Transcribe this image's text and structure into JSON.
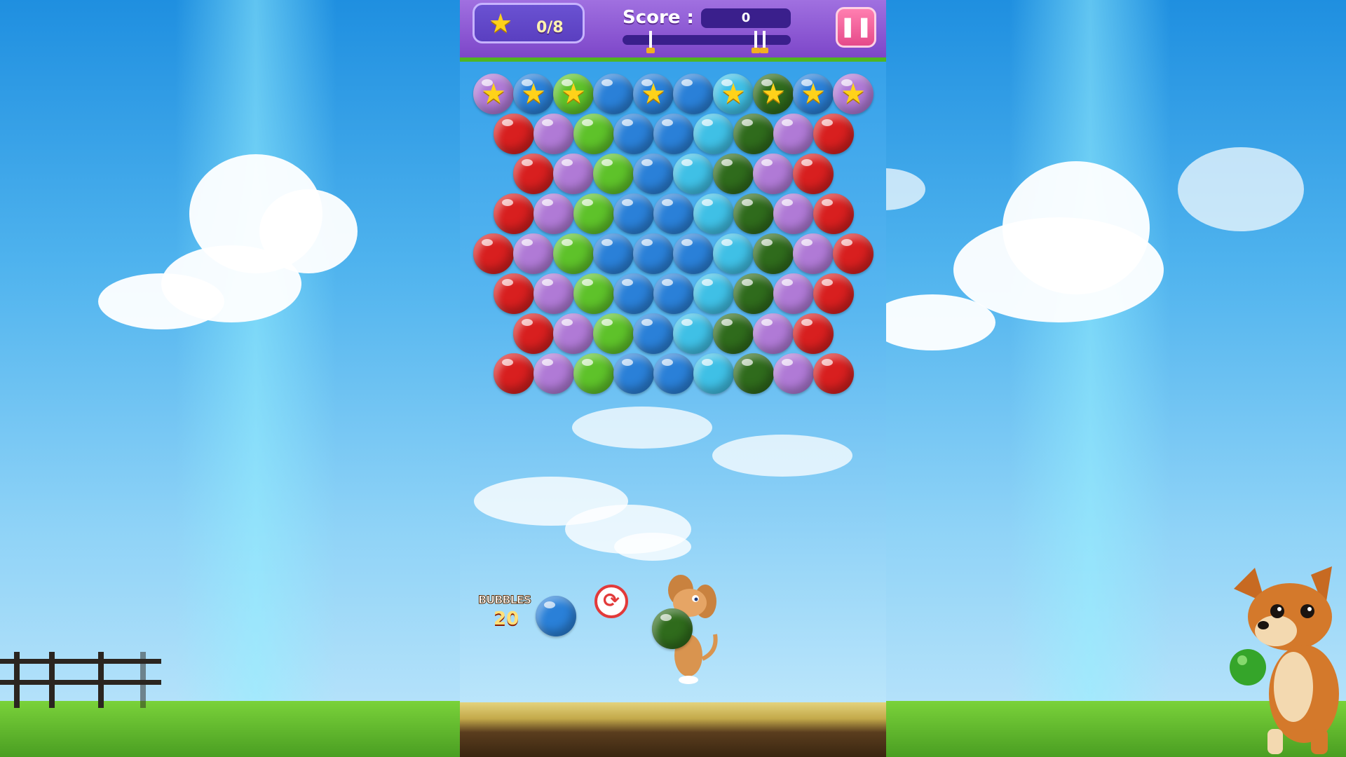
{
  "hud": {
    "star_count": "0/8",
    "score_label": "Score :",
    "score_value": "0",
    "pause_icon": "pause-icon",
    "progress_fraction": 0
  },
  "board": {
    "colors": {
      "red": "#d81f1f",
      "purple": "#b07ad6",
      "lime": "#5ec22a",
      "blue": "#2a80d8",
      "cyan": "#3fc0e6",
      "darkgreen": "#2f6b1c",
      "star": "#ffd21a"
    },
    "star_row": [
      {
        "color": "purple",
        "star": true
      },
      {
        "color": "blue",
        "star": true
      },
      {
        "color": "lime",
        "star": true
      },
      {
        "color": "blue",
        "star": false
      },
      {
        "color": "blue",
        "star": true
      },
      {
        "color": "blue",
        "star": false
      },
      {
        "color": "cyan",
        "star": true
      },
      {
        "color": "darkgreen",
        "star": true
      },
      {
        "color": "blue",
        "star": true
      },
      {
        "color": "purple",
        "star": true
      }
    ],
    "rows": [
      [
        "red",
        "purple",
        "lime",
        "blue",
        "blue",
        "cyan",
        "darkgreen",
        "purple",
        "red"
      ],
      [
        "red",
        "purple",
        "lime",
        "blue",
        "cyan",
        "darkgreen",
        "purple",
        "red"
      ],
      [
        "red",
        "purple",
        "lime",
        "blue",
        "blue",
        "cyan",
        "darkgreen",
        "purple",
        "red"
      ],
      [
        "red",
        "purple",
        "lime",
        "blue",
        "blue",
        "blue",
        "cyan",
        "darkgreen",
        "purple",
        "red"
      ],
      [
        "red",
        "purple",
        "lime",
        "blue",
        "blue",
        "cyan",
        "darkgreen",
        "purple",
        "red"
      ],
      [
        "red",
        "purple",
        "lime",
        "blue",
        "cyan",
        "darkgreen",
        "purple",
        "red"
      ],
      [
        "red",
        "purple",
        "lime",
        "blue",
        "blue",
        "cyan",
        "darkgreen",
        "purple",
        "red"
      ]
    ]
  },
  "shooter": {
    "bubbles_label": "BUBBLES",
    "bubbles_count": "20",
    "next_bubble_color": "blue",
    "current_bubble_color": "darkgreen",
    "swap_icon": "swap-icon"
  }
}
